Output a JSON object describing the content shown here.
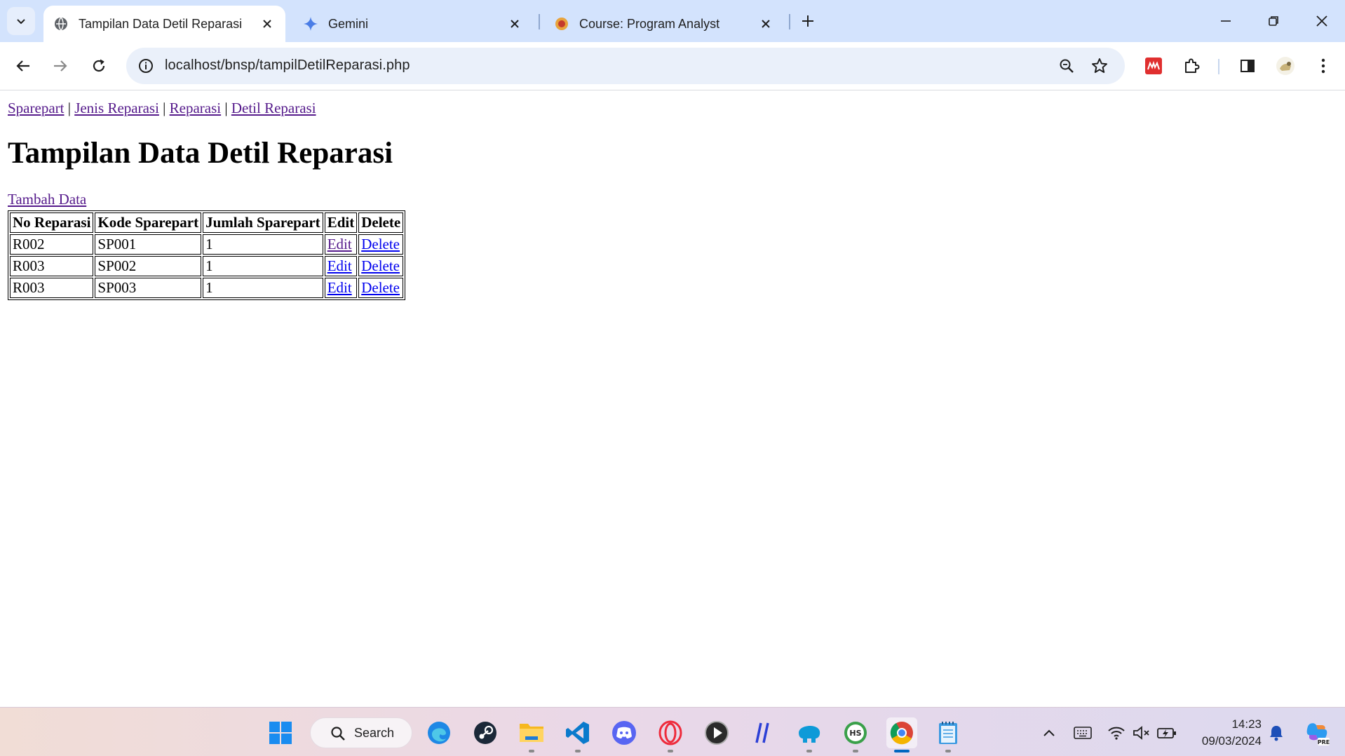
{
  "browser": {
    "tabs": [
      {
        "title": "Tampilan Data Detil Reparasi",
        "active": true,
        "favicon": "globe-icon"
      },
      {
        "title": "Gemini",
        "active": false,
        "favicon": "gemini-sparkle-icon"
      },
      {
        "title": "Course: Program Analyst",
        "active": false,
        "favicon": "course-site-icon"
      }
    ],
    "url": "localhost/bnsp/tampilDetilReparasi.php"
  },
  "page": {
    "nav_links": [
      "Sparepart",
      "Jenis Reparasi",
      "Reparasi",
      "Detil Reparasi"
    ],
    "nav_separator": "|",
    "heading": "Tampilan Data Detil Reparasi",
    "add_link": "Tambah Data",
    "table": {
      "headers": [
        "No Reparasi",
        "Kode Sparepart",
        "Jumlah Sparepart",
        "Edit",
        "Delete"
      ],
      "rows": [
        {
          "no_reparasi": "R002",
          "kode_sparepart": "SP001",
          "jumlah": "1",
          "edit": "Edit",
          "delete": "Delete"
        },
        {
          "no_reparasi": "R003",
          "kode_sparepart": "SP002",
          "jumlah": "1",
          "edit": "Edit",
          "delete": "Delete"
        },
        {
          "no_reparasi": "R003",
          "kode_sparepart": "SP003",
          "jumlah": "1",
          "edit": "Edit",
          "delete": "Delete"
        }
      ]
    }
  },
  "taskbar": {
    "search_label": "Search",
    "apps": [
      "windows-start-icon",
      "edge-icon",
      "steam-icon",
      "file-explorer-icon",
      "vscode-icon",
      "discord-icon",
      "opera-icon",
      "media-player-icon",
      "hashtag-app-icon",
      "elephant-app-icon",
      "hs-app-icon",
      "chrome-icon",
      "notepad-icon"
    ],
    "time": "14:23",
    "date": "09/03/2024"
  },
  "colors": {
    "tabstrip": "#d3e3fd",
    "visited_link": "#551a8b",
    "unvisited_link": "#0000ee"
  }
}
